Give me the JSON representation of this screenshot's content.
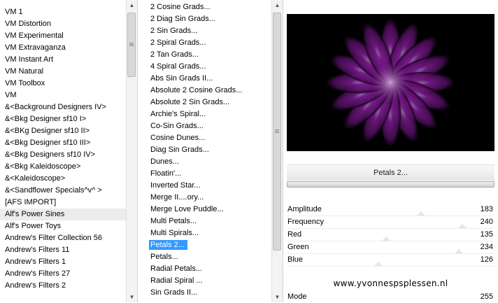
{
  "left_list": {
    "items": [
      "VM 1",
      "VM Distortion",
      "VM Experimental",
      "VM Extravaganza",
      "VM Instant Art",
      "VM Natural",
      "VM Toolbox",
      "VM",
      "&<Background Designers IV>",
      "&<Bkg Designer sf10 I>",
      "&<BKg Designer sf10 II>",
      "&<Bkg Designer sf10 III>",
      "&<Bkg Designers sf10 IV>",
      "&<Bkg Kaleidoscope>",
      "&<Kaleidoscope>",
      "&<Sandflower Specials^v^ >",
      "[AFS IMPORT]",
      "Alf's Power Sines",
      "Alf's Power Toys",
      "Andrew's Filter Collection 56",
      "Andrew's Filters 11",
      "Andrew's Filters 1",
      "Andrew's Filters 27",
      "Andrew's Filters 2"
    ],
    "hover_index": 17
  },
  "mid_list": {
    "items": [
      "2 Cosine Grads...",
      "2 Diag Sin Grads...",
      "2 Sin Grads...",
      "2 Spiral Grads...",
      "2 Tan Grads...",
      "4 Spiral Grads...",
      "Abs Sin Grads II...",
      "Absolute 2 Cosine Grads...",
      "Absolute 2 Sin Grads...",
      "Archie's Spiral...",
      "Co-Sin Grads...",
      "Cosine Dunes...",
      "Diag Sin Grads...",
      "Dunes...",
      "Floatin'...",
      "Inverted Star...",
      "Merge II....ory...",
      "Merge Love Puddle...",
      "Multi Petals...",
      "Multi Spirals...",
      "Petals 2...",
      "Petals...",
      "Radial Petals...",
      "Radial Spiral ...",
      "Sin Grads II..."
    ],
    "selected_index": 20
  },
  "filter": {
    "title": "Petals 2...",
    "params": [
      {
        "label": "Amplitude",
        "value": "183",
        "level": 0.72
      },
      {
        "label": "Frequency",
        "value": "240",
        "level": 0.94
      },
      {
        "label": "Red",
        "value": "135",
        "level": 0.53
      },
      {
        "label": "Green",
        "value": "234",
        "level": 0.92
      },
      {
        "label": "Blue",
        "value": "126",
        "level": 0.49
      }
    ],
    "mode": {
      "label": "Mode",
      "value": "255"
    }
  },
  "watermark": "www.yvonnespsplessen.nl",
  "colors": {
    "selection": "#3399ff",
    "petal": "#8a1fa0",
    "preview_bg": "#000000"
  },
  "icons": {
    "scroll_up": "triangle-up-icon",
    "scroll_down": "triangle-down-icon",
    "thumb_grip": "grip-icon"
  }
}
